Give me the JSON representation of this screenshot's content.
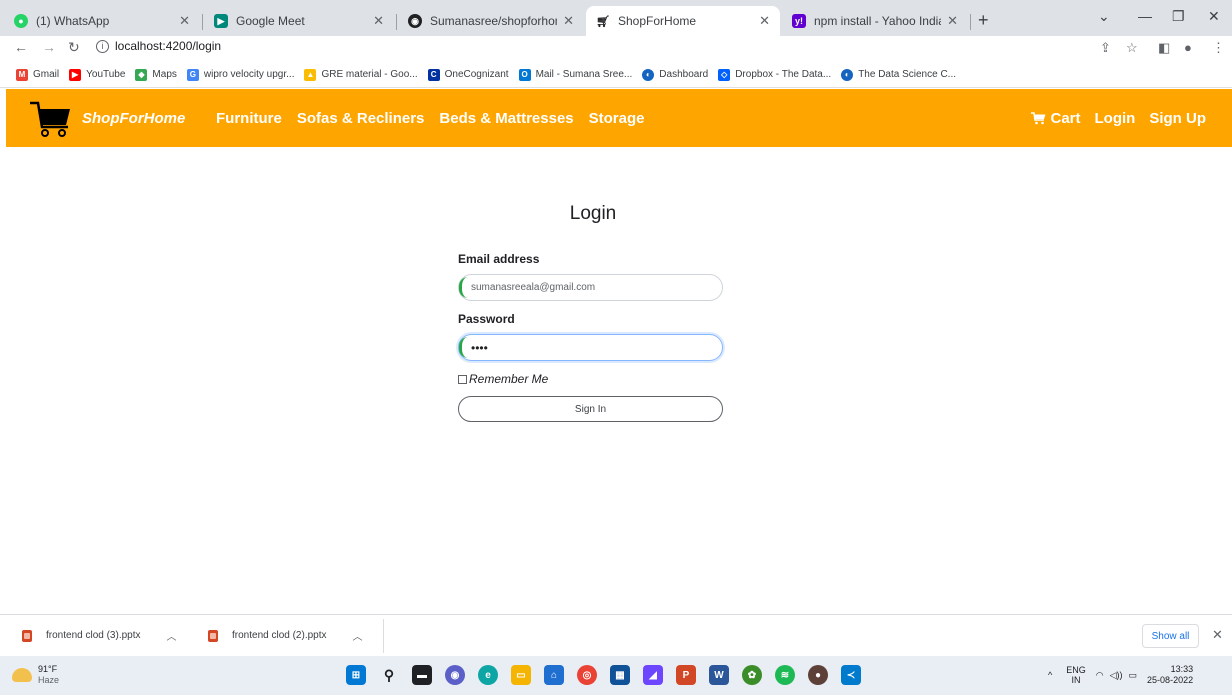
{
  "browser": {
    "tabs": [
      {
        "label": "(1) WhatsApp",
        "icon": "whatsapp-icon",
        "color": "#25d366",
        "active": false
      },
      {
        "label": "Google Meet",
        "icon": "google-meet-icon",
        "color": "#00897b",
        "active": false
      },
      {
        "label": "Sumanasree/shopforhome-wipro",
        "icon": "github-icon",
        "color": "#202124",
        "active": false
      },
      {
        "label": "ShopForHome",
        "icon": "cart-icon",
        "color": "#202124",
        "active": true
      },
      {
        "label": "npm install - Yahoo India Search",
        "icon": "yahoo-icon",
        "color": "#6001d2",
        "active": false
      }
    ],
    "url": "localhost:4200/login",
    "bookmarks": [
      {
        "label": "Gmail",
        "icon": "gmail-icon",
        "color": "#ea4335"
      },
      {
        "label": "YouTube",
        "icon": "youtube-icon",
        "color": "#ff0000"
      },
      {
        "label": "Maps",
        "icon": "maps-icon",
        "color": "#34a853"
      },
      {
        "label": "wipro velocity upgr...",
        "icon": "google-icon",
        "color": "#4285f4"
      },
      {
        "label": "GRE material - Goo...",
        "icon": "google-drive-icon",
        "color": "#fbbc04"
      },
      {
        "label": "OneCognizant",
        "icon": "cognizant-icon",
        "color": "#0033a1"
      },
      {
        "label": "Mail - Sumana Sree...",
        "icon": "outlook-icon",
        "color": "#0078d4"
      },
      {
        "label": "Dashboard",
        "icon": "dashboard-icon",
        "color": "#1565c0"
      },
      {
        "label": "Dropbox - The Data...",
        "icon": "dropbox-icon",
        "color": "#0061ff"
      },
      {
        "label": "The Data Science C...",
        "icon": "datascience-icon",
        "color": "#1565c0"
      }
    ]
  },
  "app": {
    "brand": "ShopForHome",
    "nav": [
      "Furniture",
      "Sofas & Recliners",
      "Beds & Mattresses",
      "Storage"
    ],
    "cart": "Cart",
    "login": "Login",
    "signup": "Sign Up",
    "accent": "#ffa500"
  },
  "form": {
    "title": "Login",
    "email_label": "Email address",
    "email_value": "sumanasreeala@gmail.com",
    "password_label": "Password",
    "password_value": "••••",
    "remember": "Remember Me",
    "submit": "Sign In"
  },
  "downloads": {
    "items": [
      "frontend clod (3).pptx",
      "frontend clod (2).pptx"
    ],
    "show_all": "Show all"
  },
  "taskbar": {
    "temp": "91°F",
    "condition": "Haze",
    "lang_top": "ENG",
    "lang_bottom": "IN",
    "time": "13:33",
    "date": "25-08-2022"
  }
}
